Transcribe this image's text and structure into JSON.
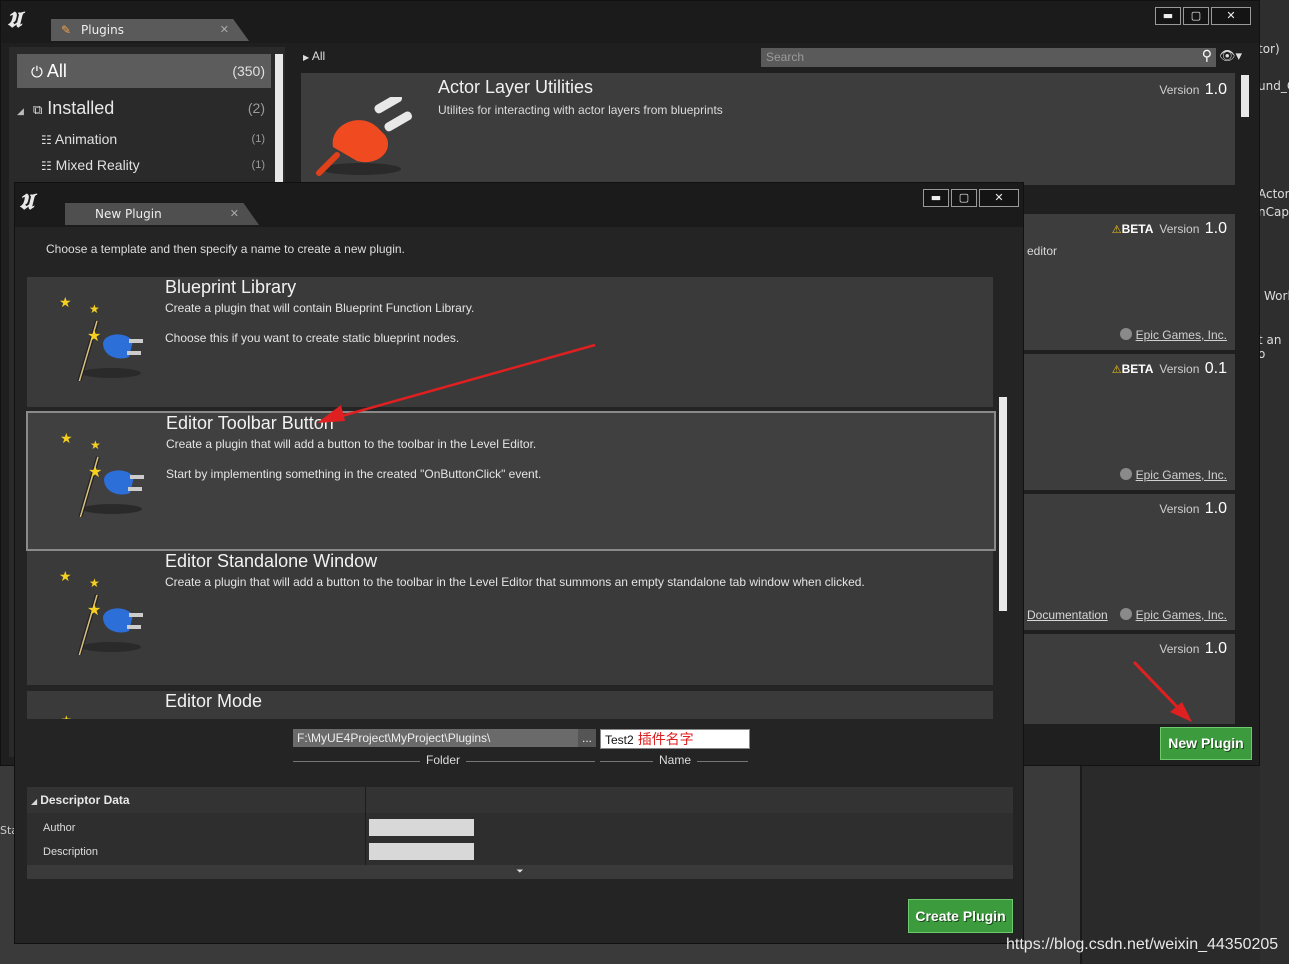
{
  "plugins_window": {
    "tab_title": "Plugins",
    "categories": [
      {
        "label": "All",
        "count": "(350)"
      },
      {
        "label": "Installed",
        "count": "(2)"
      },
      {
        "label": "Animation",
        "count": "(1)"
      },
      {
        "label": "Mixed Reality",
        "count": "(1)"
      }
    ],
    "breadcrumb": "All",
    "search_placeholder": "Search",
    "plugin_cards": [
      {
        "title": "Actor Layer Utilities",
        "description": "Utilites for interacting with actor layers from blueprints",
        "version_label": "Version",
        "version": "1.0"
      },
      {
        "beta": "BETA",
        "version_label": "Version",
        "version": "1.0",
        "text": "editor",
        "author": "Epic Games, Inc."
      },
      {
        "beta": "BETA",
        "version_label": "Version",
        "version": "0.1",
        "author": "Epic Games, Inc."
      },
      {
        "version_label": "Version",
        "version": "1.0",
        "docs": "Documentation",
        "author": "Epic Games, Inc."
      },
      {
        "version_label": "Version",
        "version": "1.0"
      }
    ],
    "new_plugin_button": "New Plugin"
  },
  "right_bg": {
    "t1": "tor)",
    "t2": "und_C",
    "t3": "Actors",
    "t4": "nCapt",
    "t5": "Worl",
    "t6": "t an o",
    "t7": "Star"
  },
  "new_plugin_dialog": {
    "tab_title": "New Plugin",
    "instruction": "Choose a template and then specify a name to create a new plugin.",
    "templates": [
      {
        "title": "Blueprint Library",
        "desc": "Create a plugin that will contain Blueprint Function Library.",
        "desc2": "Choose this if you want to create static blueprint nodes."
      },
      {
        "title": "Editor Toolbar Button",
        "desc": "Create a plugin that will add a button to the toolbar in the Level Editor.",
        "desc2": "Start by implementing something in the created \"OnButtonClick\" event."
      },
      {
        "title": "Editor Standalone Window",
        "desc": "Create a plugin that will add a button to the toolbar in the Level Editor that summons an empty standalone tab window when clicked.",
        "desc2": ""
      },
      {
        "title": "Editor Mode",
        "desc": "",
        "desc2": ""
      }
    ],
    "folder_value": "F:\\MyUE4Project\\MyProject\\Plugins\\",
    "browse_label": "...",
    "folder_label": "Folder",
    "name_value": "Test2",
    "name_annotation": "插件名字",
    "name_label": "Name",
    "descriptor_header": "Descriptor Data",
    "descriptor_rows": [
      {
        "label": "Author",
        "value": ""
      },
      {
        "label": "Description",
        "value": ""
      }
    ],
    "create_button": "Create Plugin"
  },
  "watermark": "https://blog.csdn.net/weixin_44350205",
  "colors": {
    "green_button": "#3c9b3c",
    "annotation_arrow": "#e02020"
  }
}
